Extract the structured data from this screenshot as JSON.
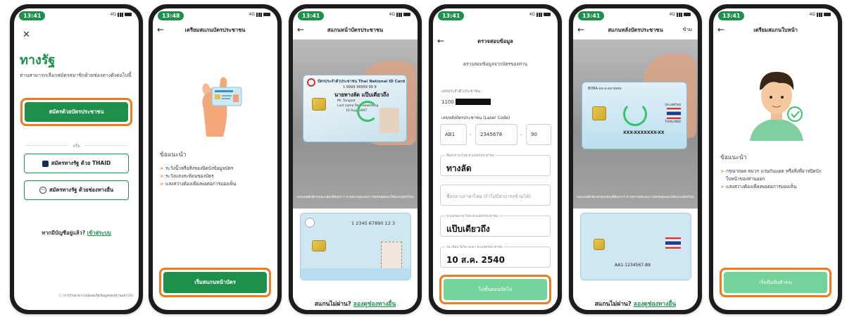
{
  "colors": {
    "brand_green": "#1f8f4c",
    "highlight_orange": "#ee7d22",
    "light_green": "#74d39a"
  },
  "screens": [
    {
      "time": "13:41",
      "close_icon": "close-icon",
      "app_title": "ทางรัฐ",
      "intro": "ท่านสามารถเลือกสมัครสมาชิกด้วยช่องทางดังต่อไปนี้",
      "primary_button": "สมัครด้วยบัตรประชาชน",
      "or_label": "หรือ",
      "thaid_button": "สมัครทางรัฐ ด้วย THAID",
      "other_button": "สมัครทางรัฐ ด้วยช่องทางอื่น",
      "login_prompt": "หากมีบัญชีอยู่แล้ว?",
      "login_link": "เข้าสู่ระบบ",
      "privacy": "การรักษาความปลอดภัยข้อมูลของท่านอย่างไร"
    },
    {
      "time": "13:48",
      "title": "เตรียมสแกนบัตรประชาชน",
      "advice_head": "ข้อแนะนำ",
      "advice": [
        "ระวังนิ้วหรือสิ่งของปิดบังข้อมูลบัตร",
        "ระวังแสงสะท้อนของบัตร",
        "แสงสว่างต้องเพียงพอต่อการมองเห็น"
      ],
      "button": "เริ่มสแกนหน้าบัตร"
    },
    {
      "time": "13:41",
      "title": "สแกนหน้าบัตรประชาชน",
      "card_header": "บัตรประจำตัวประชาชน Thai National ID Card",
      "card_number": "1 9999 99999 99 9",
      "card_name_th": "นายทางลัด แป๊บเดียวถึง",
      "card_name_en": "Mr. Tanglad",
      "card_lastname_en": "Last name Pepnaewteung",
      "card_dob": "10 Aug. 1997",
      "caption": "ขอบเขตสีเขียวครอบกล้องที่ต้องการ หากตรวจสอบพบว่าบัตรหลุดขอบให้สแกนบัตรใหม่",
      "back_number": "1 2345 67890 12 3",
      "fail_text": "สแกนไม่ผ่าน?",
      "fail_link": "ลองดูช่องทางอื่น"
    },
    {
      "time": "13:41",
      "title": "ตรวจสอบข้อมูล",
      "subtitle": "ตรวจสอบข้อมูลจากบัตรของท่าน",
      "id_label": "เลขประจำตัวประชาชน",
      "id_prefix": "1100",
      "laser_label": "เลขหลังบัตรประชาชน (Laser Code)",
      "laser_parts": [
        "AB1",
        "2345678",
        "90"
      ],
      "firstname_label": "ชื่อตัวภาษาไทย ตามบัตรประชาชน",
      "firstname": "ทางลัด",
      "middlename_placeholder": "ชื่อกลางภาษาไทย (ถ้าไม่มีสามารถข้ามได้)",
      "lastname_label": "นามสกุลภาษาไทย ตามบัตรประชาชน",
      "lastname": "แป๊บเดียวถึง",
      "dob_label": "วัน เดือน ปีเกิด (พ.ศ.) ตามบัตรประชาชน",
      "dob": "10 ส.ค. 2540",
      "button": "ไปขั้นตอนถัดไป"
    },
    {
      "time": "13:41",
      "title": "สแกนหลังบัตรประชาชน",
      "skip": "ข้าม",
      "card_code": "BORA-xx-x-xx-xxxx",
      "card_serial": "XXX-XXXXXXX-XX",
      "country": "ประเทศไทย",
      "country_en": "THAILAND",
      "caption": "ขอบเขตสีเขียวครอบกล้องที่ต้องการ หากตรวจสอบพบว่าบัตรหลุดขอบให้สแกนบัตรใหม่",
      "back_serial": "AA1-1234567-89",
      "fail_text": "สแกนไม่ผ่าน?",
      "fail_link": "ลองดูช่องทางอื่น"
    },
    {
      "time": "13:41",
      "title": "เตรียมสแกนใบหน้า",
      "advice_head": "ข้อแนะนำ",
      "advice": [
        "กรุณาถอด หมวก แว่นกันแดด หรือสิ่งที่อาจปิดบังใบหน้าของท่านออก",
        "แสงสว่างต้องเพียงพอต่อการมองเห็น"
      ],
      "button": "เริ่มยืนยันตัวตน"
    }
  ]
}
